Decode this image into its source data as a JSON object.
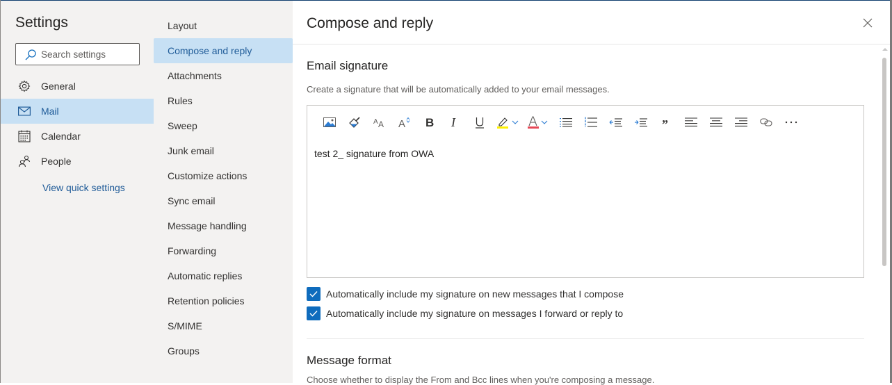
{
  "sidebar": {
    "title": "Settings",
    "search_placeholder": "Search settings",
    "items": [
      {
        "label": "General",
        "icon": "gear-icon"
      },
      {
        "label": "Mail",
        "icon": "mail-icon",
        "active": true
      },
      {
        "label": "Calendar",
        "icon": "calendar-icon"
      },
      {
        "label": "People",
        "icon": "people-icon"
      }
    ],
    "quick_settings_link": "View quick settings"
  },
  "subnav": {
    "items": [
      {
        "label": "Layout"
      },
      {
        "label": "Compose and reply",
        "active": true
      },
      {
        "label": "Attachments"
      },
      {
        "label": "Rules"
      },
      {
        "label": "Sweep"
      },
      {
        "label": "Junk email"
      },
      {
        "label": "Customize actions"
      },
      {
        "label": "Sync email"
      },
      {
        "label": "Message handling"
      },
      {
        "label": "Forwarding"
      },
      {
        "label": "Automatic replies"
      },
      {
        "label": "Retention policies"
      },
      {
        "label": "S/MIME"
      },
      {
        "label": "Groups"
      }
    ]
  },
  "main": {
    "title": "Compose and reply",
    "signature": {
      "heading": "Email signature",
      "description": "Create a signature that will be automatically added to your email messages.",
      "content": "test 2_ signature from OWA",
      "toolbar": [
        "insert-picture",
        "format-painter",
        "font-size",
        "increase-font",
        "bold",
        "italic",
        "underline",
        "highlight",
        "font-color",
        "bullets",
        "numbering",
        "decrease-indent",
        "increase-indent",
        "quote",
        "align-left",
        "align-center",
        "align-right",
        "link",
        "more-options"
      ],
      "options": [
        {
          "label": "Automatically include my signature on new messages that I compose",
          "checked": true
        },
        {
          "label": "Automatically include my signature on messages I forward or reply to",
          "checked": true
        }
      ]
    },
    "message_format": {
      "heading": "Message format",
      "description": "Choose whether to display the From and Bcc lines when you're composing a message."
    }
  },
  "colors": {
    "accent": "#0f6cbd",
    "selected_bg": "#c7e0f4",
    "link": "#1f5b98",
    "highlight_yellow": "#fff100",
    "font_red": "#e74856"
  }
}
